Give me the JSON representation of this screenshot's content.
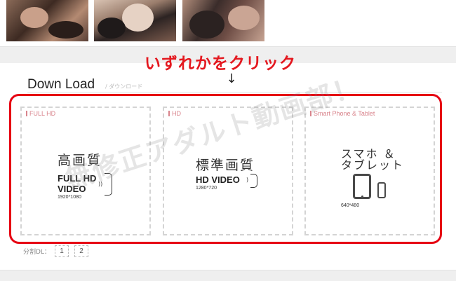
{
  "thumbnails": [
    "thumb-1",
    "thumb-2",
    "thumb-3"
  ],
  "instruction": "いずれかをクリック",
  "arrow": "↓",
  "download": {
    "title": "Down Load",
    "subtitle": "/  ダウンロード"
  },
  "cards": [
    {
      "label": "FULL HD",
      "quality_jp": "高画質",
      "video_line1": "FULL HD",
      "video_line2": "VIDEO",
      "resolution": "1920*1080"
    },
    {
      "label": "HD",
      "quality_jp": "標準画質",
      "video_line1": "HD VIDEO",
      "resolution": "1280*720"
    },
    {
      "label": "Smart Phone & Tablet",
      "line1": "スマホ ＆",
      "line2": "タブレット",
      "resolution": "640*480"
    }
  ],
  "watermark": "無修正アダルト動画部！",
  "split": {
    "label": "分割DL：",
    "parts": [
      "1",
      "2"
    ]
  },
  "colors": {
    "accent_red": "#e60012",
    "label_pink": "#d9848c"
  }
}
